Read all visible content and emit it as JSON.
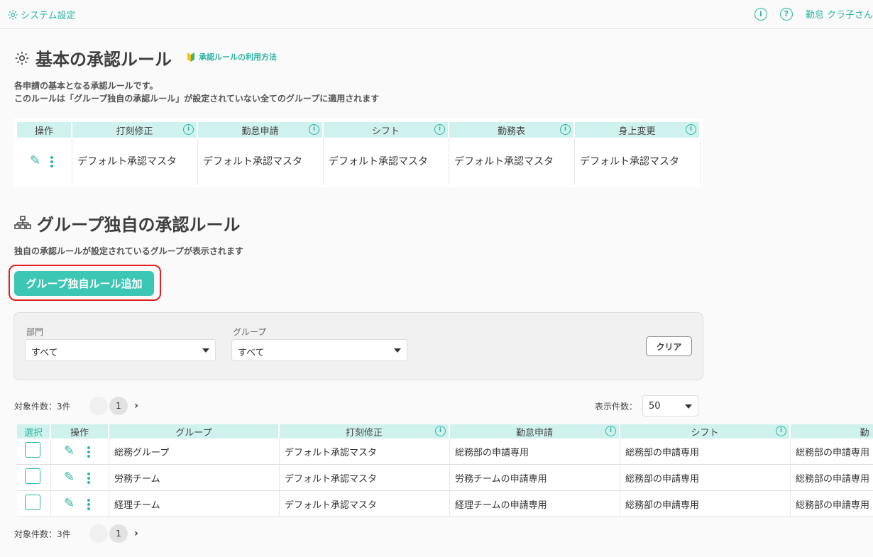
{
  "topbar": {
    "system_settings": "システム設定",
    "user_name": "勤怠 クラ子さん",
    "info_icon_glyph": "i",
    "help_icon_glyph": "?"
  },
  "basic": {
    "title": "基本の承認ルール",
    "help_link": "承認ルールの利用方法",
    "desc_line1": "各申請の基本となる承認ルールです。",
    "desc_line2": "このルールは「グループ独自の承認ルール」が設定されていない全てのグループに適用されます",
    "headers": [
      "操作",
      "打刻修正",
      "勤怠申請",
      "シフト",
      "勤務表",
      "身上変更"
    ],
    "row": [
      "デフォルト承認マスタ",
      "デフォルト承認マスタ",
      "デフォルト承認マスタ",
      "デフォルト承認マスタ",
      "デフォルト承認マスタ"
    ]
  },
  "group": {
    "title": "グループ独自の承認ルール",
    "desc": "独自の承認ルールが設定されているグループが表示されます",
    "add_button": "グループ独自ルール追加",
    "filter": {
      "dept_label": "部門",
      "dept_value": "すべて",
      "group_label": "グループ",
      "group_value": "すべて",
      "clear": "クリア"
    },
    "count_label": "対象件数：3件",
    "page": "1",
    "next": "›",
    "per_page_label": "表示件数：",
    "per_page_value": "50",
    "headers": [
      "選択",
      "操作",
      "グループ",
      "打刻修正",
      "勤怠申請",
      "シフト",
      "勤"
    ],
    "rows": [
      [
        "総務グループ",
        "デフォルト承認マスタ",
        "総務部の申請専用",
        "総務部の申請専用",
        "総務部の申請専用"
      ],
      [
        "労務チーム",
        "デフォルト承認マスタ",
        "労務チームの申請専用",
        "総務部の申請専用",
        "総務部の申請専用"
      ],
      [
        "経理チーム",
        "デフォルト承認マスタ",
        "経理チームの申請専用",
        "総務部の申請専用",
        "総務部の申請専用"
      ]
    ]
  },
  "colors": {
    "accent": "#3cc6b4",
    "header_bg": "#d0f2ee",
    "highlight": "#e02020"
  }
}
